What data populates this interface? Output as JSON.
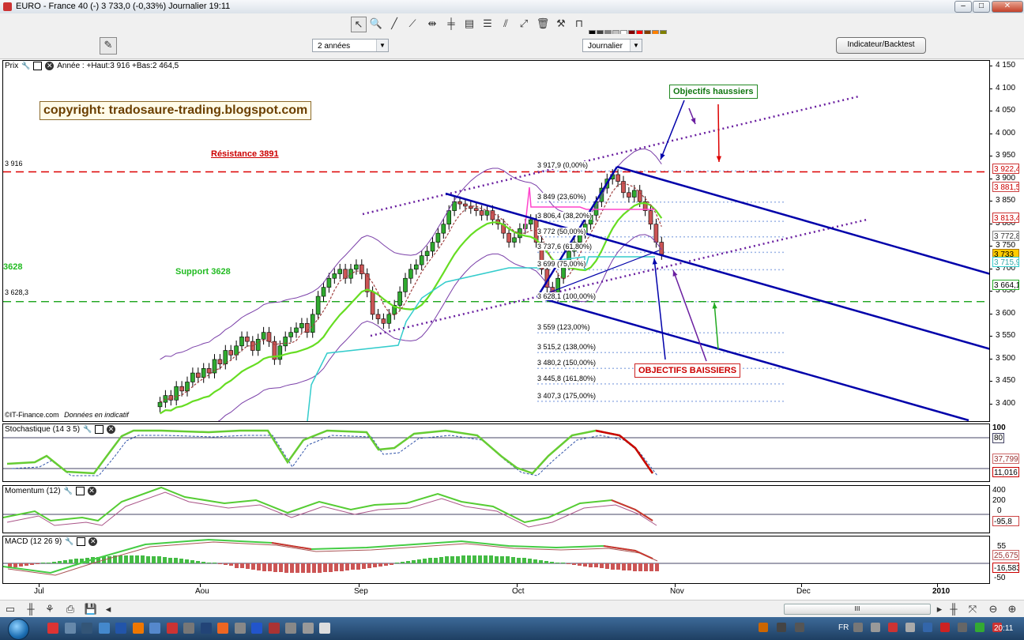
{
  "window": {
    "title": "EURO - France 40 (-)    3 733,0 (-0,33%)    Journalier  19:11"
  },
  "toolbar": {
    "period_value": "2 années",
    "interval_value": "Journalier",
    "indicator_button": "Indicateur/Backtest"
  },
  "price_pane": {
    "label": "Prix",
    "info": "Année : +Haut:3 916 +Bas:2 464,5",
    "copyright": "copyright: tradosaure-trading.blogspot.com",
    "source": "©IT-Finance.com",
    "source_note": "Données en indicatif",
    "annotations": {
      "resistance": "Résistance 3891",
      "support": "Support 3628",
      "left_tag": "3628",
      "bull_targets": "Objectifs haussiers",
      "bear_targets": "OBJECTIFS BAISSIERS"
    },
    "level_labels": {
      "level_3916": "3 916",
      "level_3628": "3 628,3"
    },
    "fib_levels": [
      "3 917,9 (0,00%)",
      "3 849 (23,60%)",
      "3 806,4 (38,20%)",
      "3 772 (50,00%)",
      "3 737,6 (61,80%)",
      "3 699 (75,00%)",
      "3 628,1 (100,00%)",
      "3 559 (123,00%)",
      "3 515,2 (138,00%)",
      "3 480,2 (150,00%)",
      "3 445,8 (161,80%)",
      "3 407,3 (175,00%)"
    ],
    "y_ticks": [
      "4 150",
      "4 100",
      "4 050",
      "4 000",
      "3 950",
      "3 900",
      "3 850",
      "3 800",
      "3 750",
      "3 700",
      "3 650",
      "3 600",
      "3 550",
      "3 500",
      "3 450",
      "3 400"
    ],
    "price_tags": [
      "3 922,4",
      "3 881,5",
      "3 813,4",
      "3 772,8",
      "3 733",
      "3 715,9",
      "3 664,1"
    ]
  },
  "stoch_pane": {
    "label": "Stochastique (14 3 5)",
    "y_ticks": [
      "100",
      "80"
    ],
    "tags": [
      "80",
      "37,799",
      "11,016"
    ]
  },
  "momentum_pane": {
    "label": "Momentum (12)",
    "y_ticks": [
      "400",
      "200",
      "0"
    ],
    "tags": [
      "-95,8"
    ]
  },
  "macd_pane": {
    "label": "MACD (12 26 9)",
    "y_ticks": [
      "55",
      "-50"
    ],
    "tags": [
      "25,675",
      "-16,583"
    ]
  },
  "x_axis": [
    "Jul",
    "Aou",
    "Sep",
    "Oct",
    "Nov",
    "Dec",
    "2010"
  ],
  "statusbar": {
    "scroll_label": "III"
  },
  "taskbar": {
    "lang": "FR",
    "time": "20:11"
  },
  "colors": {
    "resistance": "#dd0000",
    "support": "#009900",
    "channel": "#0000aa",
    "dotted_channel": "#6a1fa0",
    "ma_green": "#66dd22",
    "bollinger": "#7a3fa8",
    "cyan": "#33cccc",
    "magenta": "#ff44cc"
  }
}
